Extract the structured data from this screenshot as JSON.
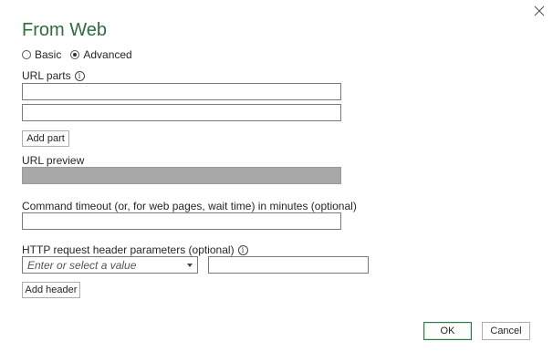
{
  "dialog": {
    "title": "From Web",
    "close_icon": "close-icon"
  },
  "mode": {
    "options": [
      {
        "label": "Basic",
        "selected": false
      },
      {
        "label": "Advanced",
        "selected": true
      }
    ]
  },
  "url_parts": {
    "label": "URL parts",
    "info_icon": "info-icon",
    "values": [
      "",
      ""
    ],
    "add_part_label": "Add part"
  },
  "url_preview": {
    "label": "URL preview",
    "value": ""
  },
  "command_timeout": {
    "label": "Command timeout (or, for web pages, wait time) in minutes (optional)",
    "value": ""
  },
  "http_headers": {
    "label": "HTTP request header parameters (optional)",
    "info_icon": "info-icon",
    "name_placeholder": "Enter or select a value",
    "value": "",
    "add_header_label": "Add header"
  },
  "footer": {
    "ok_label": "OK",
    "cancel_label": "Cancel"
  }
}
